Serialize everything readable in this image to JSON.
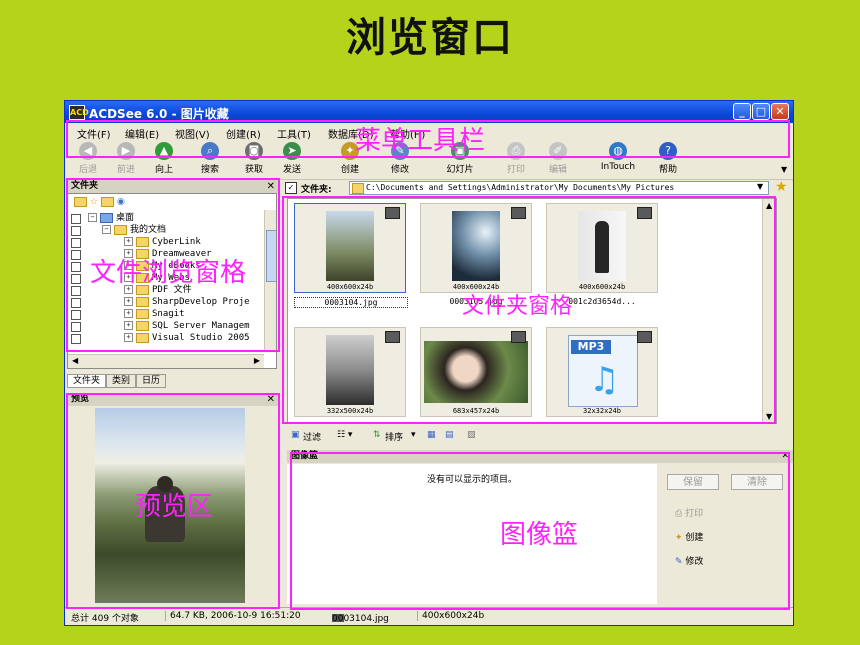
{
  "slide": {
    "title": "浏览窗口"
  },
  "window": {
    "title": "ACDSee 6.0 - 图片收藏",
    "app_icon": "ACD"
  },
  "menu": [
    "文件(F)",
    "编辑(E)",
    "视图(V)",
    "创建(R)",
    "工具(T)",
    "数据库(D)",
    "帮助(H)"
  ],
  "toolbar": [
    {
      "label": "后退",
      "icon": "back-arrow",
      "enabled": false
    },
    {
      "label": "前进",
      "icon": "forward-arrow",
      "enabled": false
    },
    {
      "label": "向上",
      "icon": "up-arrow",
      "enabled": true
    },
    {
      "label": "搜索",
      "icon": "search",
      "enabled": true
    },
    {
      "label": "获取",
      "icon": "camera",
      "enabled": true
    },
    {
      "label": "发送",
      "icon": "send",
      "enabled": true
    },
    {
      "label": "创建",
      "icon": "wand",
      "enabled": true
    },
    {
      "label": "修改",
      "icon": "edit",
      "enabled": true
    },
    {
      "label": "幻灯片",
      "icon": "slideshow",
      "enabled": true
    },
    {
      "label": "打印",
      "icon": "print",
      "enabled": false
    },
    {
      "label": "编辑",
      "icon": "editor",
      "enabled": false
    },
    {
      "label": "InTouch",
      "icon": "globe",
      "enabled": true
    },
    {
      "label": "帮助",
      "icon": "help",
      "enabled": true
    }
  ],
  "folders_panel": {
    "title": "文件夹",
    "tree": [
      {
        "label": "桌面",
        "level": 0
      },
      {
        "label": "我的文档",
        "level": 1
      },
      {
        "label": "CyberLink",
        "level": 2
      },
      {
        "label": "Dreamweaver",
        "level": 2
      },
      {
        "label": "My eBooks",
        "level": 2
      },
      {
        "label": "My Webs",
        "level": 2
      },
      {
        "label": "PDF 文件",
        "level": 2
      },
      {
        "label": "SharpDevelop Proje",
        "level": 2
      },
      {
        "label": "Snagit",
        "level": 2
      },
      {
        "label": "SQL Server Managem",
        "level": 2
      },
      {
        "label": "Visual Studio 2005",
        "level": 2
      }
    ],
    "tabs": [
      "文件夹",
      "类别",
      "日历"
    ]
  },
  "preview_panel": {
    "title": "预览"
  },
  "path_bar": {
    "label": "文件夹:",
    "path": "C:\\Documents and Settings\\Administrator\\My Documents\\My Pictures"
  },
  "thumbnails": [
    {
      "dims": "400x600x24b",
      "name": "0003104.jpg",
      "kind": "photo-seaside"
    },
    {
      "dims": "400x600x24b",
      "name": "0003105.jpg",
      "kind": "photo-light"
    },
    {
      "dims": "400x600x24b",
      "name": "001c2d3654d...",
      "kind": "photo-dress"
    },
    {
      "dims": "332x500x24b",
      "name": "",
      "kind": "photo-portrait"
    },
    {
      "dims": "683x457x24b",
      "name": "",
      "kind": "photo-face"
    },
    {
      "dims": "32x32x24b",
      "name": "",
      "kind": "mp3-icon"
    }
  ],
  "filter_bar": {
    "filter": "过滤",
    "sort": "排序"
  },
  "image_basket": {
    "title": "图像篮",
    "empty_text": "没有可以显示的项目。",
    "buttons": [
      "保留",
      "清除"
    ],
    "actions": [
      "打印",
      "创建",
      "修改"
    ]
  },
  "statusbar": {
    "total": "总计 409 个对象",
    "size": "64.7 KB, 2006-10-9 16:51:20",
    "file": "0003104.jpg",
    "dims": "400x600x24b"
  },
  "annotations": {
    "menu_toolbar": "菜单工具栏",
    "folder_browser": "文件浏览窗格",
    "folder_window": "文件夹窗格",
    "preview": "预览区",
    "basket": "图像篮"
  },
  "colors": {
    "slide_bg": "#b6d31b",
    "highlight": "#ff22ff",
    "titlebar": "#0a47d8"
  }
}
